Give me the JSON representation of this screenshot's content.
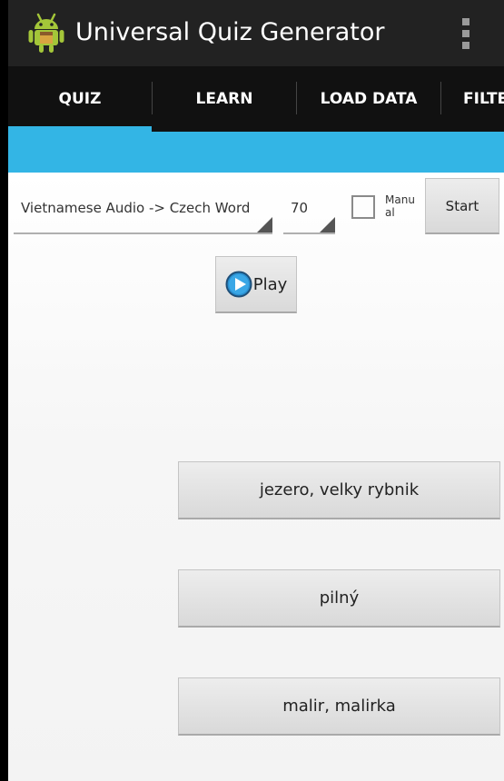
{
  "app_bar": {
    "title": "Universal Quiz Generator",
    "app_icon": "android-robot-icon",
    "overflow_icon": "overflow-menu-icon"
  },
  "tabs": [
    {
      "label": "QUIZ",
      "selected": true
    },
    {
      "label": "LEARN",
      "selected": false
    },
    {
      "label": "LOAD DATA",
      "selected": false
    },
    {
      "label": "FILTE",
      "selected": false
    }
  ],
  "colors": {
    "accent": "#33b5e5",
    "action_bar": "#222222",
    "tab_bar": "#111111"
  },
  "quiz": {
    "mode_select": "Vietnamese Audio -> Czech Word",
    "count_select": "70",
    "manual_label": "Manual",
    "manual_checked": false,
    "start_label": "Start",
    "play_label": "Play",
    "play_icon": "play-circle-icon",
    "answers": [
      "jezero, velky rybnik",
      "pilný",
      "malir, malirka"
    ]
  }
}
